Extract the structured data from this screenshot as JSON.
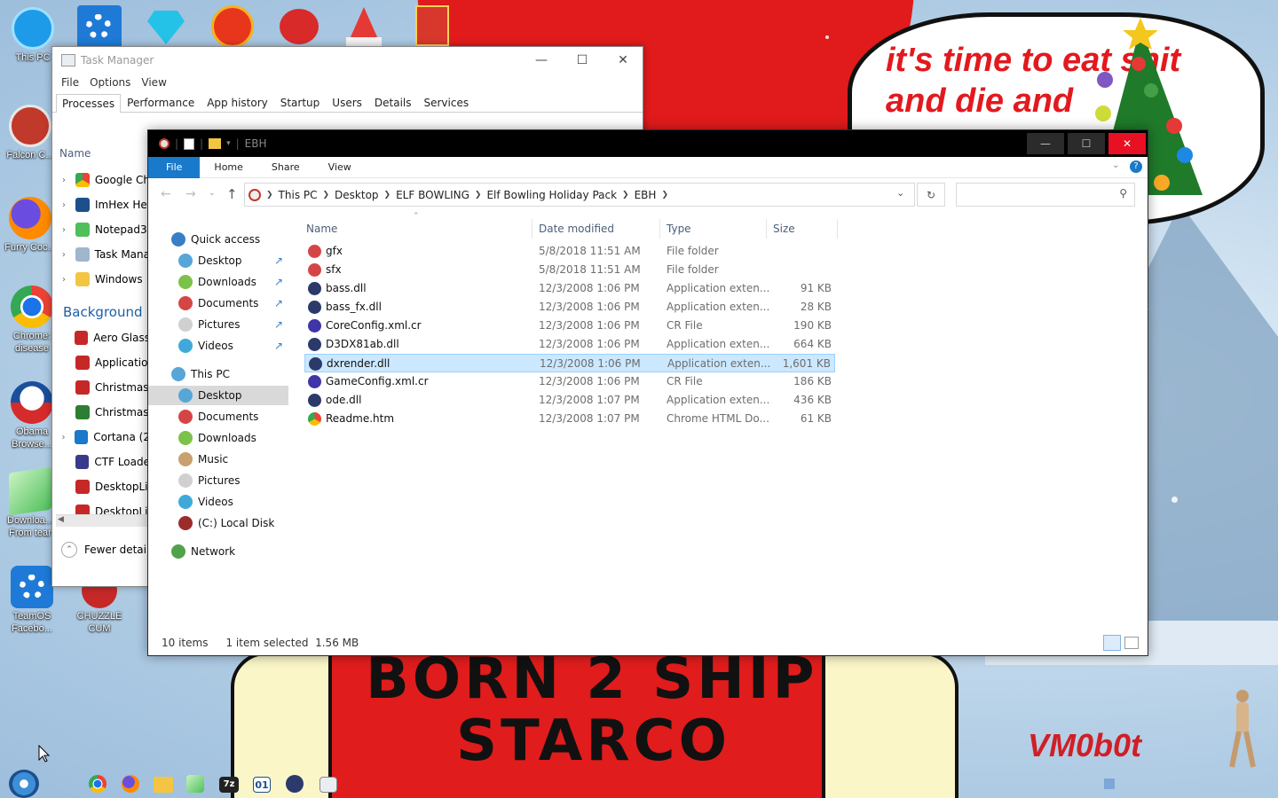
{
  "desktop": {
    "wallpaper": {
      "speech_line1": "it's time to eat shit",
      "speech_line2": "and die and",
      "shirt_line1": "BORN 2 SHIP",
      "shirt_line2": "STARCO",
      "signature": "VM0b0t"
    },
    "icons": [
      {
        "label": "This PC",
        "icon": "monitor-icon"
      },
      {
        "label": "Falcon C...",
        "icon": "falcon-icon"
      },
      {
        "label": "Furry Coc...",
        "icon": "firefox-icon"
      },
      {
        "label": "Chrome: disease",
        "icon": "chrome-icon"
      },
      {
        "label": "Obama Browse...",
        "icon": "obama-logo-icon"
      },
      {
        "label": "Downloa... From tear",
        "icon": "download-icon"
      },
      {
        "label": "TeamOS Facebo...",
        "icon": "gear-icon"
      },
      {
        "label": "CHUZZLE CUM",
        "icon": "chuzzle-icon"
      }
    ]
  },
  "task_manager": {
    "title": "Task Manager",
    "menu": [
      "File",
      "Options",
      "View"
    ],
    "tabs": [
      "Processes",
      "Performance",
      "App history",
      "Startup",
      "Users",
      "Details",
      "Services"
    ],
    "active_tab": "Processes",
    "column_name": "Name",
    "apps": [
      {
        "label": "Google Ch",
        "icon": "chrome-icon",
        "expandable": true
      },
      {
        "label": "ImHex He",
        "icon": "imhex-icon",
        "expandable": true
      },
      {
        "label": "Notepad3",
        "icon": "notepad-icon",
        "expandable": true
      },
      {
        "label": "Task Mana",
        "icon": "task-manager-icon",
        "expandable": true
      },
      {
        "label": "Windows",
        "icon": "folder-icon",
        "expandable": true
      }
    ],
    "background_header": "Background p",
    "background": [
      {
        "label": "Aero Glass",
        "icon": "app-icon",
        "expandable": false
      },
      {
        "label": "Applicatio",
        "icon": "app-icon",
        "expandable": false
      },
      {
        "label": "Christmas",
        "icon": "app-icon",
        "expandable": false
      },
      {
        "label": "Christmas",
        "icon": "tree-icon",
        "expandable": false
      },
      {
        "label": "Cortana (2",
        "icon": "cortana-icon",
        "expandable": true
      },
      {
        "label": "CTF Loade",
        "icon": "ctf-icon",
        "expandable": false
      },
      {
        "label": "DesktopLi",
        "icon": "app-icon",
        "expandable": false
      },
      {
        "label": "DesktopLi",
        "icon": "app-icon",
        "expandable": false
      }
    ],
    "fewer_details": "Fewer details"
  },
  "explorer": {
    "title": "EBH",
    "ribbon_tabs": [
      "File",
      "Home",
      "Share",
      "View"
    ],
    "breadcrumb": [
      "This PC",
      "Desktop",
      "ELF BOWLING",
      "Elf Bowling Holiday Pack",
      "EBH"
    ],
    "search_placeholder": "",
    "nav": {
      "quick_access": "Quick access",
      "quick_items": [
        "Desktop",
        "Downloads",
        "Documents",
        "Pictures",
        "Videos"
      ],
      "this_pc": "This PC",
      "pc_items": [
        "Desktop",
        "Documents",
        "Downloads",
        "Music",
        "Pictures",
        "Videos",
        "(C:) Local Disk"
      ],
      "network": "Network",
      "selected": "Desktop"
    },
    "columns": {
      "name": "Name",
      "date": "Date modified",
      "type": "Type",
      "size": "Size"
    },
    "files": [
      {
        "name": "gfx",
        "date": "5/8/2018 11:51 AM",
        "type": "File folder",
        "size": "",
        "icon": "folder-icon"
      },
      {
        "name": "sfx",
        "date": "5/8/2018 11:51 AM",
        "type": "File folder",
        "size": "",
        "icon": "folder-icon"
      },
      {
        "name": "bass.dll",
        "date": "12/3/2008 1:06 PM",
        "type": "Application exten...",
        "size": "91 KB",
        "icon": "dll-icon"
      },
      {
        "name": "bass_fx.dll",
        "date": "12/3/2008 1:06 PM",
        "type": "Application exten...",
        "size": "28 KB",
        "icon": "dll-icon"
      },
      {
        "name": "CoreConfig.xml.cr",
        "date": "12/3/2008 1:06 PM",
        "type": "CR File",
        "size": "190 KB",
        "icon": "cr-file-icon"
      },
      {
        "name": "D3DX81ab.dll",
        "date": "12/3/2008 1:06 PM",
        "type": "Application exten...",
        "size": "664 KB",
        "icon": "dll-icon"
      },
      {
        "name": "dxrender.dll",
        "date": "12/3/2008 1:06 PM",
        "type": "Application exten...",
        "size": "1,601 KB",
        "icon": "dll-icon"
      },
      {
        "name": "GameConfig.xml.cr",
        "date": "12/3/2008 1:06 PM",
        "type": "CR File",
        "size": "186 KB",
        "icon": "cr-file-icon"
      },
      {
        "name": "ode.dll",
        "date": "12/3/2008 1:07 PM",
        "type": "Application exten...",
        "size": "436 KB",
        "icon": "dll-icon"
      },
      {
        "name": "Readme.htm",
        "date": "12/3/2008 1:07 PM",
        "type": "Chrome HTML Do...",
        "size": "61 KB",
        "icon": "chrome-icon"
      }
    ],
    "selected_file": "dxrender.dll",
    "status_items": "10 items",
    "status_selected": "1 item selected  1.56 MB"
  },
  "taskbar": {
    "icons": [
      "start-orb-icon",
      "chrome-icon",
      "firefox-icon",
      "file-explorer-icon",
      "notepad-icon",
      "7zip-icon",
      "imhex-icon",
      "bomb-icon",
      "task-manager-icon"
    ],
    "seven_zip_label": "7z",
    "imhex_label": "01"
  },
  "colors": {
    "accent": "#1979ca",
    "selection": "#cce8ff",
    "close_red": "#e81123",
    "wallpaper_red": "#e11b1b"
  }
}
